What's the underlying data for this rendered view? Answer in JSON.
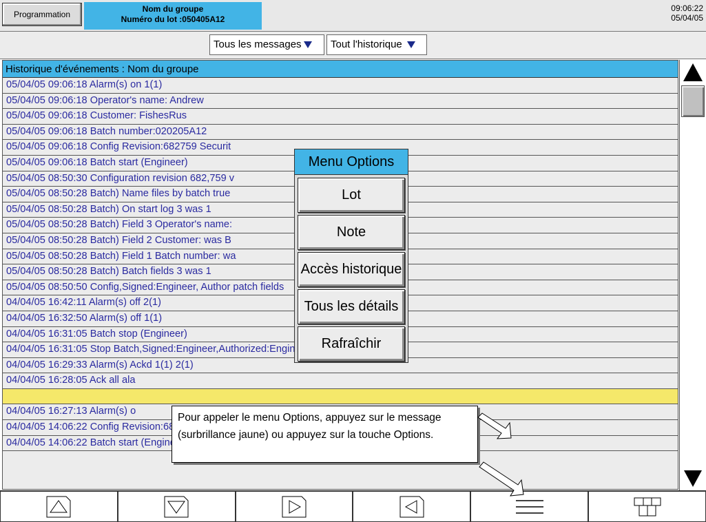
{
  "header": {
    "programming_button": "Programmation",
    "group_name": "Nom du groupe",
    "batch_number": "Numéro du lot :050405A12",
    "time": "09:06:22",
    "date": "05/04/05"
  },
  "filters": {
    "messages": "Tous les messages",
    "history": "Tout l'historique"
  },
  "events": {
    "title": "Historique d'événements : Nom du groupe",
    "rows": [
      "05/04/05 09:06:18 Alarm(s) on 1(1)",
      "05/04/05 09:06:18 Operator's name: Andrew",
      "05/04/05 09:06:18 Customer: FishesRus",
      "05/04/05 09:06:18 Batch number:020205A12",
      "05/04/05 09:06:18 Config Revision:682759 Securit",
      "05/04/05 09:06:18 Batch start (Engineer)",
      "05/04/05 08:50:30 Configuration revision 682,759 v",
      "05/04/05 08:50:28 Batch) Name files by batch true",
      "05/04/05 08:50:28 Batch) On start log 3 was 1",
      "05/04/05 08:50:28 Batch) Field 3 Operator's name:",
      "05/04/05 08:50:28 Batch) Field 2 Customer: was B",
      "05/04/05 08:50:28 Batch) Field 1 Batch number: wa",
      "05/04/05 08:50:28 Batch) Batch fields 3 was 1",
      "05/04/05 08:50:50 Config,Signed:Engineer, Author                    patch fields",
      "04/04/05 16:42:11 Alarm(s) off 2(1)",
      "04/04/05 16:32:50 Alarm(s) off 1(1)",
      "04/04/05 16:31:05 Batch stop (Engineer)",
      "04/04/05 16:31:05 Stop Batch,Signed:Engineer,Authorized:Engineer,Belt Failure",
      "04/04/05 16:29:33 Alarm(s) Ackd 1(1) 2(1)",
      "04/04/05 16:28:05 Ack all ala",
      "",
      "04/04/05 16:27:13 Alarm(s) o",
      "04/04/05 14:06:22 Config Revision:682759 Security Revision 746261",
      "04/04/05 14:06:22 Batch start (Engineer)"
    ]
  },
  "menu": {
    "title": "Menu Options",
    "items": [
      "Lot",
      "Note",
      "Accès historique",
      "Tous les détails",
      "Rafraîchir"
    ]
  },
  "tooltip": "Pour appeler le menu Options, appuyez sur le message (surbrillance jaune) ou appuyez sur la touche Options.",
  "toolbar": {
    "icons": [
      "up-arrow-icon",
      "down-arrow-icon",
      "right-arrow-icon",
      "left-arrow-icon",
      "options-lines-icon",
      "grid-icon"
    ]
  },
  "colors": {
    "accent_blue": "#42b4e6",
    "highlight_yellow": "#f5e86a",
    "event_text": "#2a2aa0"
  }
}
